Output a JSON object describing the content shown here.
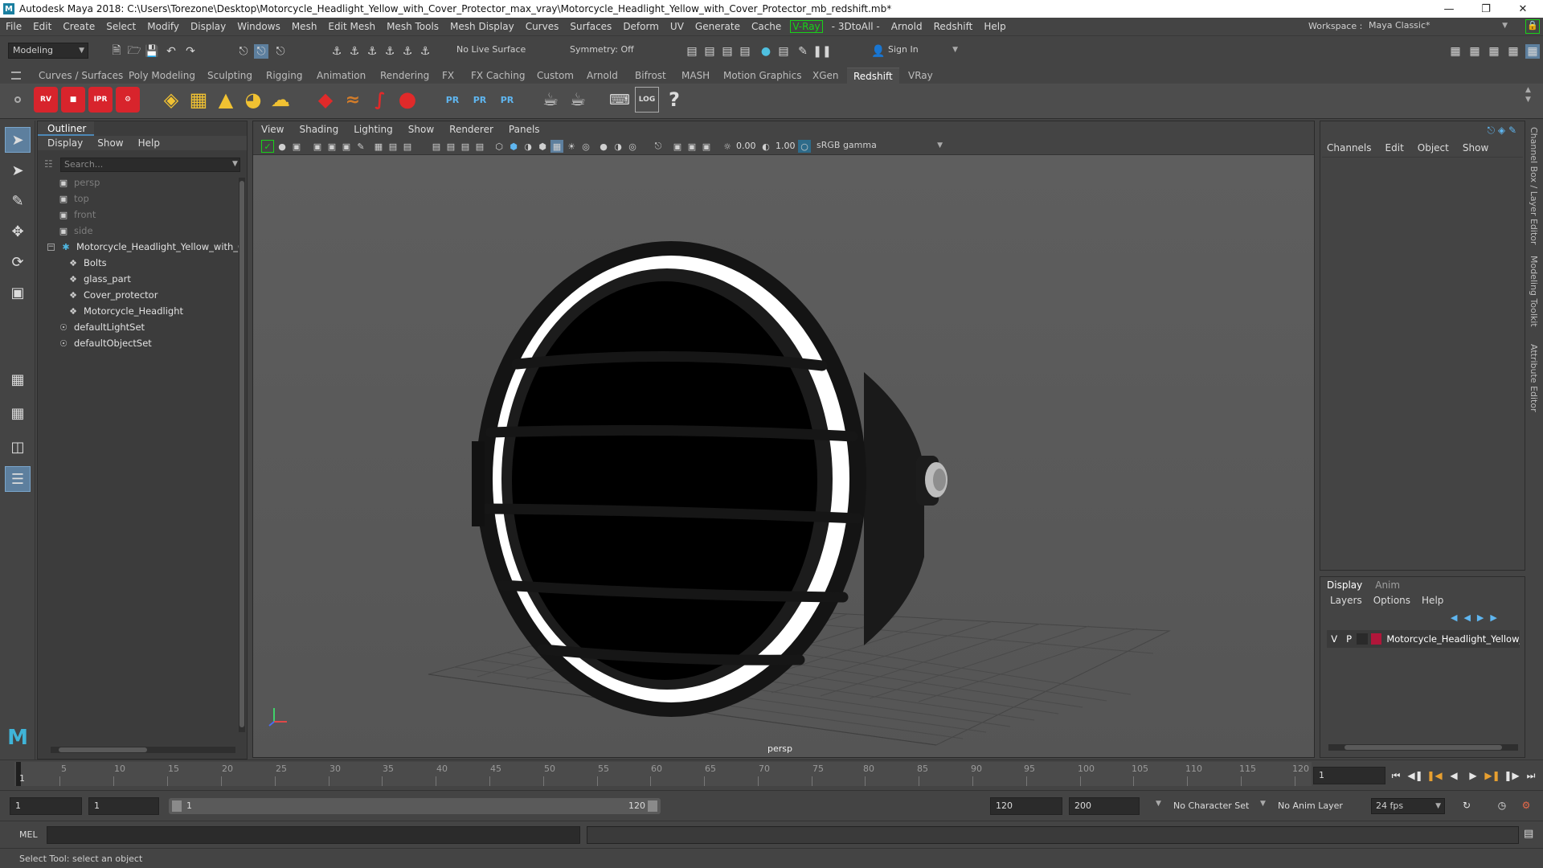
{
  "window": {
    "title": "Autodesk Maya 2018: C:\\Users\\Torezone\\Desktop\\Motorcycle_Headlight_Yellow_with_Cover_Protector_max_vray\\Motorcycle_Headlight_Yellow_with_Cover_Protector_mb_redshift.mb*",
    "logo_letter": "M"
  },
  "menubar": {
    "items": [
      "File",
      "Edit",
      "Create",
      "Select",
      "Modify",
      "Display",
      "Windows",
      "Mesh",
      "Edit Mesh",
      "Mesh Tools",
      "Mesh Display",
      "Curves",
      "Surfaces",
      "Deform",
      "UV",
      "Generate",
      "Cache"
    ],
    "vray": "V-Ray",
    "items2": [
      "- 3DtoAll -",
      "Arnold",
      "Redshift",
      "Help"
    ],
    "workspace_label": "Workspace :",
    "workspace_value": "Maya Classic*"
  },
  "statusline": {
    "mode": "Modeling",
    "live_surface": "No Live Surface",
    "symmetry": "Symmetry: Off",
    "sign_in": "Sign In"
  },
  "shelf": {
    "tabs": [
      "Curves / Surfaces",
      "Poly Modeling",
      "Sculpting",
      "Rigging",
      "Animation",
      "Rendering",
      "FX",
      "FX Caching",
      "Custom",
      "Arnold",
      "Bifrost",
      "MASH",
      "Motion Graphics",
      "XGen",
      "Redshift",
      "VRay"
    ],
    "active_tab": "Redshift",
    "icons": [
      {
        "name": "redshift-rv-icon",
        "label": "RV"
      },
      {
        "name": "redshift-render-icon",
        "label": ""
      },
      {
        "name": "redshift-ipr-icon",
        "label": "IPR"
      },
      {
        "name": "redshift-settings-icon",
        "label": ""
      },
      {
        "name": "pr-export-icon",
        "label": "PR"
      },
      {
        "name": "pr-import-icon",
        "label": "PR"
      },
      {
        "name": "pr-swap-icon",
        "label": "PR"
      },
      {
        "name": "log-icon",
        "label": "LOG"
      },
      {
        "name": "help-icon",
        "label": "?"
      }
    ]
  },
  "outliner": {
    "title": "Outliner",
    "menu": [
      "Display",
      "Show",
      "Help"
    ],
    "search_placeholder": "Search...",
    "items": [
      {
        "label": "persp",
        "dim": true,
        "icon": "camera-icon"
      },
      {
        "label": "top",
        "dim": true,
        "icon": "camera-icon"
      },
      {
        "label": "front",
        "dim": true,
        "icon": "camera-icon"
      },
      {
        "label": "side",
        "dim": true,
        "icon": "camera-icon"
      },
      {
        "label": "Motorcycle_Headlight_Yellow_with_C",
        "dim": false,
        "icon": "group-icon"
      },
      {
        "label": "Bolts",
        "dim": false,
        "icon": "mesh-icon"
      },
      {
        "label": "glass_part",
        "dim": false,
        "icon": "mesh-icon"
      },
      {
        "label": "Cover_protector",
        "dim": false,
        "icon": "mesh-icon"
      },
      {
        "label": "Motorcycle_Headlight",
        "dim": false,
        "icon": "mesh-icon"
      },
      {
        "label": "defaultLightSet",
        "dim": false,
        "icon": "set-icon"
      },
      {
        "label": "defaultObjectSet",
        "dim": false,
        "icon": "set-icon"
      }
    ]
  },
  "viewport": {
    "menu": [
      "View",
      "Shading",
      "Lighting",
      "Show",
      "Renderer",
      "Panels"
    ],
    "exposure": "0.00",
    "gamma": "1.00",
    "color_space": "sRGB gamma",
    "camera": "persp"
  },
  "channelbox": {
    "menu": [
      "Channels",
      "Edit",
      "Object",
      "Show"
    ]
  },
  "layereditor": {
    "tabs": [
      "Display",
      "Anim"
    ],
    "active_tab": "Display",
    "menu": [
      "Layers",
      "Options",
      "Help"
    ],
    "layer": {
      "v": "V",
      "p": "P",
      "name": "Motorcycle_Headlight_Yellow_w",
      "color": "#b0163a"
    }
  },
  "side_tabs": [
    "Channel Box / Layer Editor",
    "Modeling Toolkit",
    "Attribute Editor"
  ],
  "timeline": {
    "ticks": [
      "1",
      "5",
      "10",
      "15",
      "20",
      "25",
      "30",
      "35",
      "40",
      "45",
      "50",
      "55",
      "60",
      "65",
      "70",
      "75",
      "80",
      "85",
      "90",
      "95",
      "100",
      "105",
      "110",
      "115",
      "120"
    ],
    "current_frame": "1"
  },
  "range": {
    "start": "1",
    "anim_start": "1",
    "slider_start": "1",
    "slider_end": "120",
    "anim_end": "120",
    "end": "200",
    "character_set": "No Character Set",
    "anim_layer": "No Anim Layer",
    "fps": "24 fps"
  },
  "mel": {
    "label": "MEL"
  },
  "help": {
    "text": "Select Tool: select an object"
  },
  "colors": {
    "accent": "#5d7f9e",
    "layer_red": "#b0163a",
    "vray_green": "#19d219"
  }
}
